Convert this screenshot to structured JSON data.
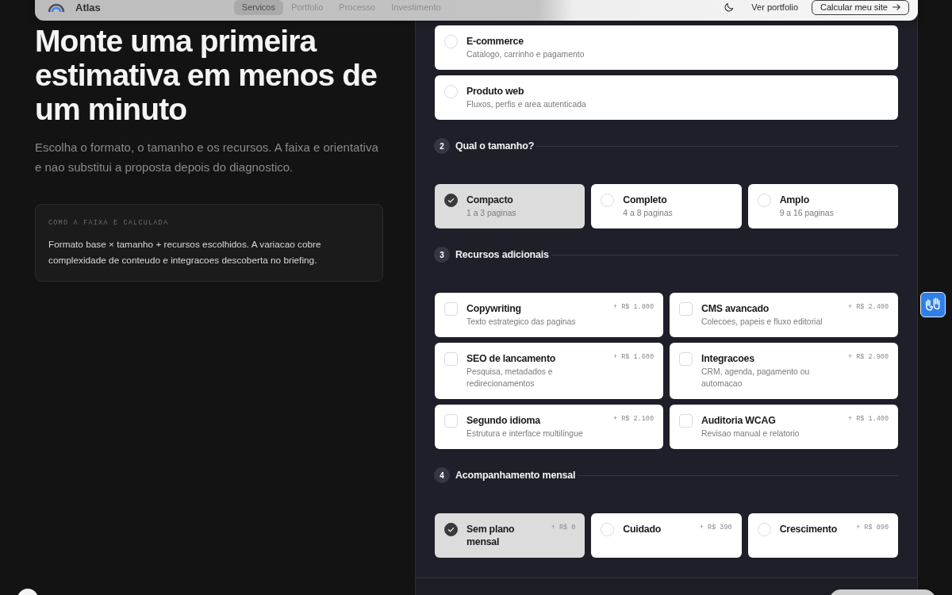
{
  "nav": {
    "brand": "Atlas",
    "links": [
      {
        "label": "Servicos",
        "selected": true
      },
      {
        "label": "Portfolio",
        "selected": false
      },
      {
        "label": "Processo",
        "selected": false
      },
      {
        "label": "Investimento",
        "selected": false
      }
    ],
    "secondary_link": "Ver portfolio",
    "cta": "Calcular meu site"
  },
  "intro": {
    "title": "Monte uma primeira estimativa em menos de um minuto",
    "lead": "Escolha o formato, o tamanho e os recursos. A faixa e orientativa e nao substitui a proposta depois do diagnostico.",
    "note": {
      "label": "COMO A FAIXA E CALCULADA",
      "text": "Formato base × tamanho + recursos escolhidos. A variacao cobre complexidade de conteudo e integracoes descoberta no briefing."
    }
  },
  "estimator": {
    "sections": [
      {
        "kind": "list",
        "options": [
          {
            "title": "E-commerce",
            "subtitle": "Catalogo, carrinho e pagamento",
            "selected": false
          },
          {
            "title": "Produto web",
            "subtitle": "Fluxos, perfis e area autenticada",
            "selected": false
          }
        ]
      },
      {
        "kind": "radio",
        "number": "2",
        "title": "Qual o tamanho?",
        "options": [
          {
            "title": "Compacto",
            "subtitle": "1 a 3 paginas",
            "selected": true
          },
          {
            "title": "Completo",
            "subtitle": "4 a 8 paginas",
            "selected": false
          },
          {
            "title": "Amplo",
            "subtitle": "9 a 16 paginas",
            "selected": false
          }
        ]
      },
      {
        "kind": "checkbox",
        "number": "3",
        "title": "Recursos adicionais",
        "options": [
          {
            "title": "Copywriting",
            "subtitle": "Texto estrategico das paginas",
            "price": "+ R$ 1.800",
            "checked": false
          },
          {
            "title": "CMS avancado",
            "subtitle": "Colecoes, papeis e fluxo editorial",
            "price": "+ R$ 2.400",
            "checked": false
          },
          {
            "title": "SEO de lancamento",
            "subtitle": "Pesquisa, metadados e redirecionamentos",
            "price": "+ R$ 1.600",
            "checked": false
          },
          {
            "title": "Integracoes",
            "subtitle": "CRM, agenda, pagamento ou automacao",
            "price": "+ R$ 2.900",
            "checked": false
          },
          {
            "title": "Segundo idioma",
            "subtitle": "Estrutura e interface multilíngue",
            "price": "+ R$ 2.100",
            "checked": false
          },
          {
            "title": "Auditoria WCAG",
            "subtitle": "Revisao manual e relatorio",
            "price": "+ R$ 1.400",
            "checked": false
          }
        ]
      },
      {
        "kind": "radio",
        "number": "4",
        "title": "Acompanhamento mensal",
        "options": [
          {
            "title": "Sem plano mensal",
            "price": "+ R$ 0",
            "selected": true
          },
          {
            "title": "Cuidado",
            "price": "+ R$ 390",
            "selected": false
          },
          {
            "title": "Crescimento",
            "price": "+ R$ 890",
            "selected": false
          }
        ]
      }
    ]
  }
}
